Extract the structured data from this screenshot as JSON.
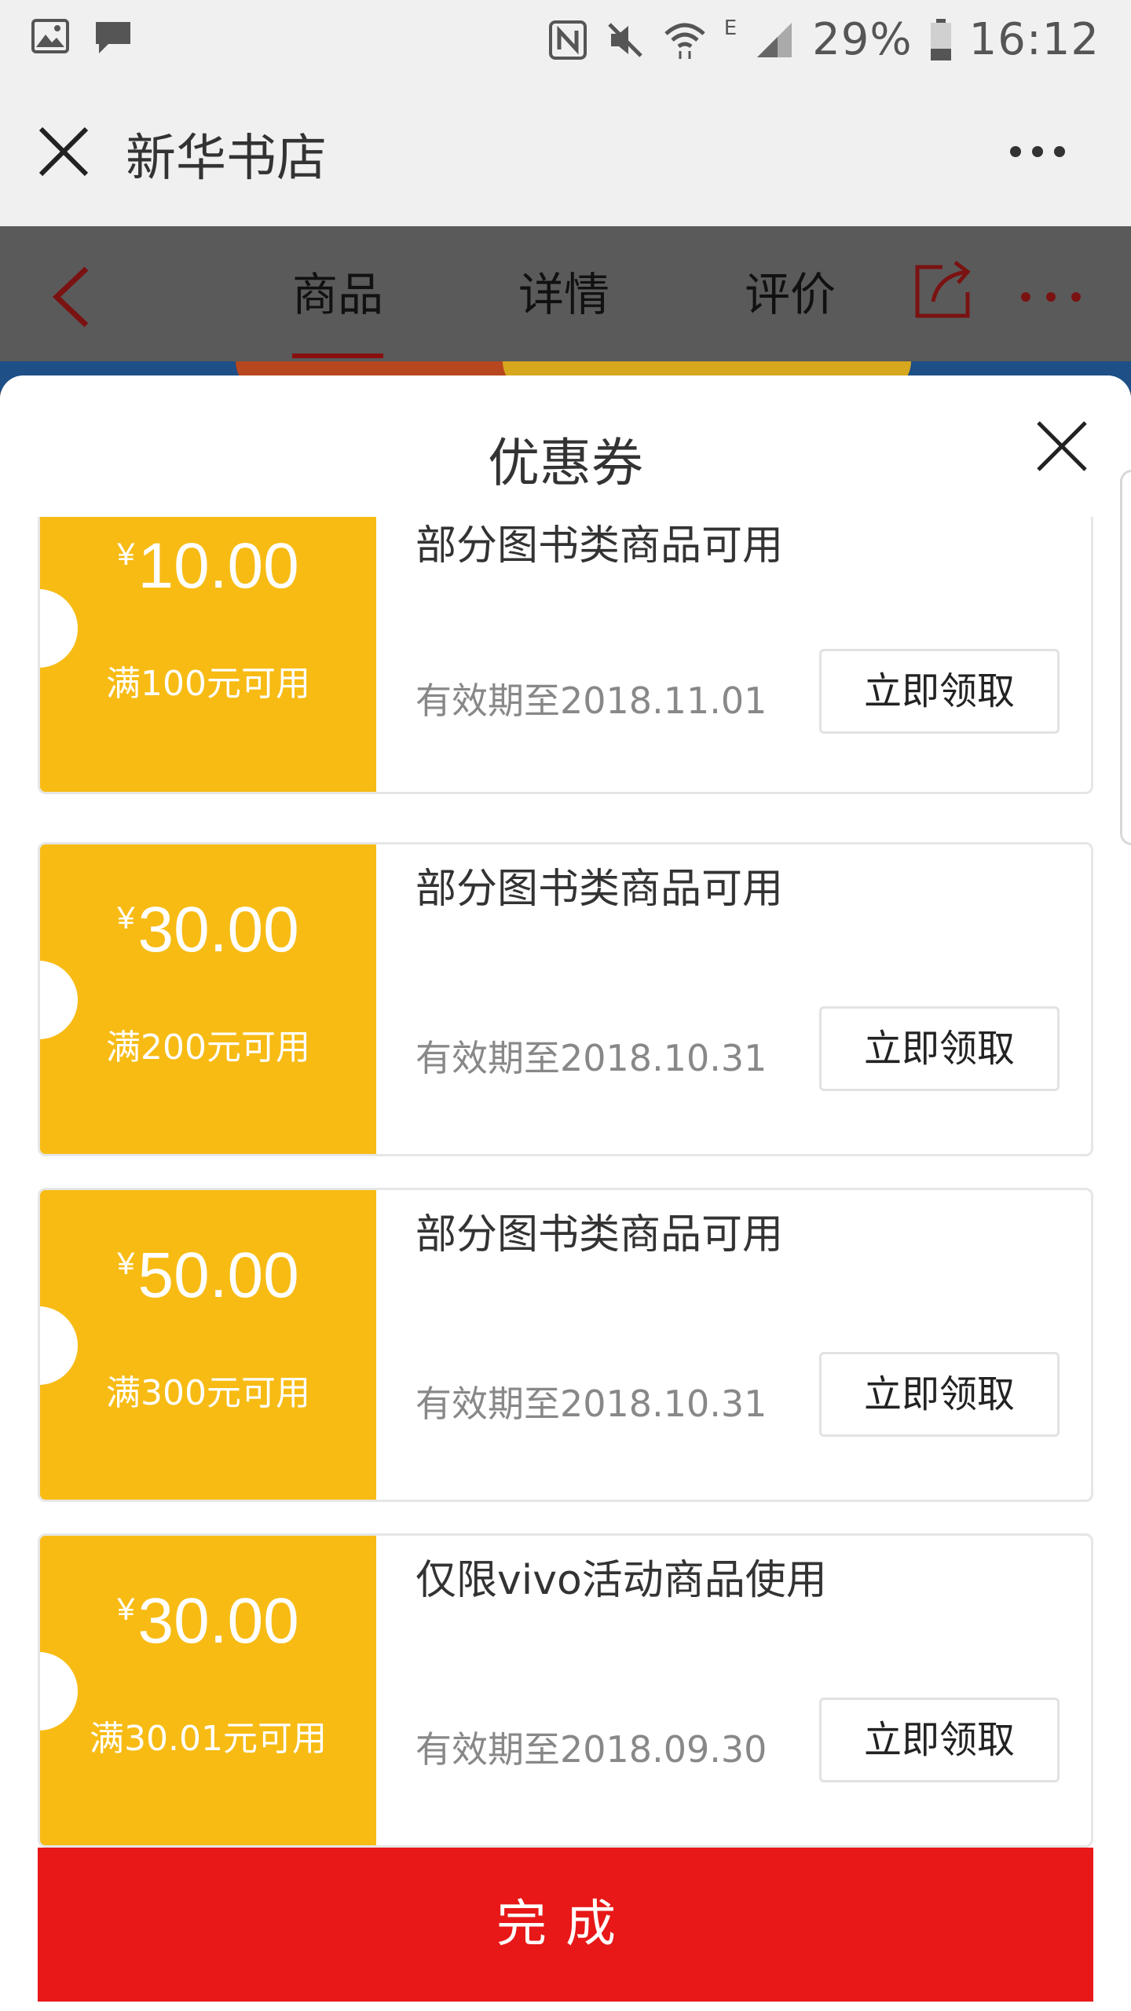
{
  "status_bar": {
    "battery": "29%",
    "time": "16:12",
    "network": "E"
  },
  "app_bar": {
    "title": "新华书店"
  },
  "product_tabs": [
    "商品",
    "详情",
    "评价"
  ],
  "sheet": {
    "title": "优惠券",
    "coupons": [
      {
        "currency": "¥",
        "amount": "10.00",
        "threshold": "满100元可用",
        "description": "部分图书类商品可用",
        "expiry": "有效期至2018.11.01",
        "button": "立即领取"
      },
      {
        "currency": "¥",
        "amount": "30.00",
        "threshold": "满200元可用",
        "description": "部分图书类商品可用",
        "expiry": "有效期至2018.10.31",
        "button": "立即领取"
      },
      {
        "currency": "¥",
        "amount": "50.00",
        "threshold": "满300元可用",
        "description": "部分图书类商品可用",
        "expiry": "有效期至2018.10.31",
        "button": "立即领取"
      },
      {
        "currency": "¥",
        "amount": "30.00",
        "threshold": "满30.01元可用",
        "description": "仅限vivo活动商品使用",
        "expiry": "有效期至2018.09.30",
        "button": "立即领取"
      }
    ],
    "done_button": "完成"
  },
  "colors": {
    "coupon_accent": "#f7bb14",
    "done_button": "#e81818",
    "tab_accent": "#8a0f0f"
  }
}
